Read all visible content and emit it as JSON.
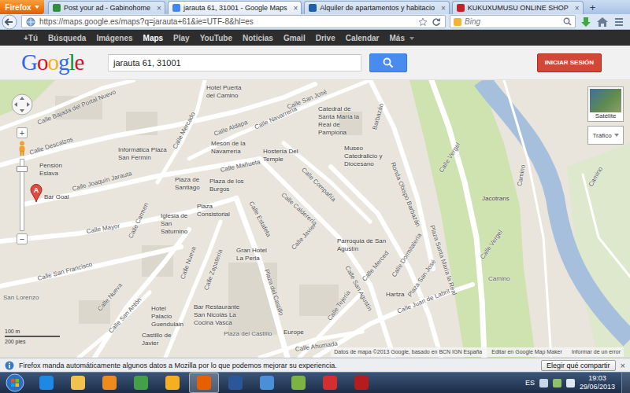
{
  "browser": {
    "app_button": "Firefox",
    "tabs": [
      {
        "label": "Post your ad - Gabinohome",
        "selected": false
      },
      {
        "label": "jarauta 61, 31001 - Google Maps",
        "selected": true
      },
      {
        "label": "Alquiler de apartamentos y habitacio",
        "selected": false
      },
      {
        "label": "KUKUXUMUSU ONLINE SHOP",
        "selected": false
      }
    ],
    "tab_close": "×",
    "new_tab": "+",
    "url": "https://maps.google.es/maps?q=jarauta+61&ie=UTF-8&hl=es",
    "search_placeholder": "Bing"
  },
  "google_bar": {
    "items": [
      {
        "label": "+Tú",
        "selected": false,
        "dropdown": false
      },
      {
        "label": "Búsqueda",
        "selected": false,
        "dropdown": false
      },
      {
        "label": "Imágenes",
        "selected": false,
        "dropdown": false
      },
      {
        "label": "Maps",
        "selected": true,
        "dropdown": false
      },
      {
        "label": "Play",
        "selected": false,
        "dropdown": false
      },
      {
        "label": "YouTube",
        "selected": false,
        "dropdown": false
      },
      {
        "label": "Noticias",
        "selected": false,
        "dropdown": false
      },
      {
        "label": "Gmail",
        "selected": false,
        "dropdown": false
      },
      {
        "label": "Drive",
        "selected": false,
        "dropdown": false
      },
      {
        "label": "Calendar",
        "selected": false,
        "dropdown": false
      },
      {
        "label": "Más",
        "selected": false,
        "dropdown": true
      }
    ]
  },
  "header": {
    "logo": "Google",
    "query": "jarauta 61, 31001",
    "sign_in": "INICIAR SESIÓN"
  },
  "map": {
    "zoom_in": "+",
    "zoom_out": "−",
    "satellite": "Satélite",
    "traffic": "Tráfico",
    "marker": "A",
    "labels": [
      {
        "text": "Calle Bajada del Portal Nuevo",
        "kind": "street"
      },
      {
        "text": "Hotel Puerta del Camino",
        "kind": "poi"
      },
      {
        "text": "Calle San José",
        "kind": "street"
      },
      {
        "text": "Calle Descalzos",
        "kind": "street"
      },
      {
        "text": "Calle Aldapa",
        "kind": "street"
      },
      {
        "text": "Calle Mercado",
        "kind": "street"
      },
      {
        "text": "Calle Navarrería",
        "kind": "street"
      },
      {
        "text": "Catedral de Santa María la Real de Pamplona",
        "kind": "poi"
      },
      {
        "text": "Barbazán",
        "kind": "street"
      },
      {
        "text": "Ronda Obispo Barbazán",
        "kind": "street"
      },
      {
        "text": "Calle Vergel",
        "kind": "street"
      },
      {
        "text": "Pensión Eslava",
        "kind": "poi"
      },
      {
        "text": "Informática Plaza San Fermín",
        "kind": "poi"
      },
      {
        "text": "Mesón de la Navarrería",
        "kind": "poi"
      },
      {
        "text": "Hostería Del Temple",
        "kind": "poi"
      },
      {
        "text": "Museo Catedralicio y Diocesano",
        "kind": "poi"
      },
      {
        "text": "Calle Mañueta",
        "kind": "street"
      },
      {
        "text": "Plaza de Santiago",
        "kind": "poi"
      },
      {
        "text": "Plaza de los Burgos",
        "kind": "poi"
      },
      {
        "text": "Calle Compañía",
        "kind": "street"
      },
      {
        "text": "Calle Joaquín Jarauta",
        "kind": "street"
      },
      {
        "text": "Bar Goal",
        "kind": "poi"
      },
      {
        "text": "Plaza Consistorial",
        "kind": "poi"
      },
      {
        "text": "Iglesia de San Saturnino",
        "kind": "poi"
      },
      {
        "text": "Calle Calderería",
        "kind": "street"
      },
      {
        "text": "Calle Mayor",
        "kind": "street"
      },
      {
        "text": "Calle Carmen",
        "kind": "street"
      },
      {
        "text": "Calle Estafeta",
        "kind": "street"
      },
      {
        "text": "Calle Nueva",
        "kind": "street"
      },
      {
        "text": "Calle Zapatería",
        "kind": "street"
      },
      {
        "text": "Gran Hotel La Perla",
        "kind": "poi"
      },
      {
        "text": "Calle Javier",
        "kind": "street"
      },
      {
        "text": "Parroquia de San Agustín",
        "kind": "poi"
      },
      {
        "text": "Calle Merced",
        "kind": "street"
      },
      {
        "text": "Calle Dormitalería",
        "kind": "street"
      },
      {
        "text": "Plaza San José",
        "kind": "street"
      },
      {
        "text": "Plaza Santa María la Real",
        "kind": "street"
      },
      {
        "text": "Jacotrans",
        "kind": "poi"
      },
      {
        "text": "Camino",
        "kind": "street"
      },
      {
        "text": "Camino",
        "kind": "street"
      },
      {
        "text": "Calle Vergel",
        "kind": "street"
      },
      {
        "text": "Camino",
        "kind": "street"
      },
      {
        "text": "Calle San Francisco",
        "kind": "street"
      },
      {
        "text": "San Lorenzo",
        "kind": "street"
      },
      {
        "text": "Calle Nueva",
        "kind": "street"
      },
      {
        "text": "Calle San Antón",
        "kind": "street"
      },
      {
        "text": "Hotel Palacio Guendulain",
        "kind": "poi"
      },
      {
        "text": "Bar Restaurante San Nicolás La Cocina Vasca",
        "kind": "poi"
      },
      {
        "text": "Castillo de Javier",
        "kind": "poi"
      },
      {
        "text": "Plaza del Castillo",
        "kind": "street"
      },
      {
        "text": "Plaza del Castillo",
        "kind": "street"
      },
      {
        "text": "Calle San Agustín",
        "kind": "street"
      },
      {
        "text": "Calle Tejería",
        "kind": "street"
      },
      {
        "text": "Hartza",
        "kind": "poi"
      },
      {
        "text": "Calle Juan de Labrit",
        "kind": "street"
      },
      {
        "text": "Europe",
        "kind": "poi"
      },
      {
        "text": "Calle Ahumada",
        "kind": "street"
      }
    ],
    "scale": {
      "metric": "100 m",
      "imperial": "200 pies"
    },
    "attribution": [
      "Datos de mapa ©2013 Google, basado en BCN IGN España",
      "Editar en Google Map Maker",
      "Informar de un error"
    ]
  },
  "notification": {
    "text": "Firefox manda automáticamente algunos datos a Mozilla por lo que podemos mejorar su experiencia.",
    "button": "Elegir qué compartir",
    "close": "×"
  },
  "taskbar": {
    "apps": [
      {
        "active": false
      },
      {
        "active": false
      },
      {
        "active": false
      },
      {
        "active": false
      },
      {
        "active": false
      },
      {
        "active": true
      },
      {
        "active": false
      },
      {
        "active": false
      },
      {
        "active": false
      },
      {
        "active": false
      },
      {
        "active": false
      }
    ],
    "language": "ES",
    "time": "19:03",
    "date": "29/06/2013"
  }
}
